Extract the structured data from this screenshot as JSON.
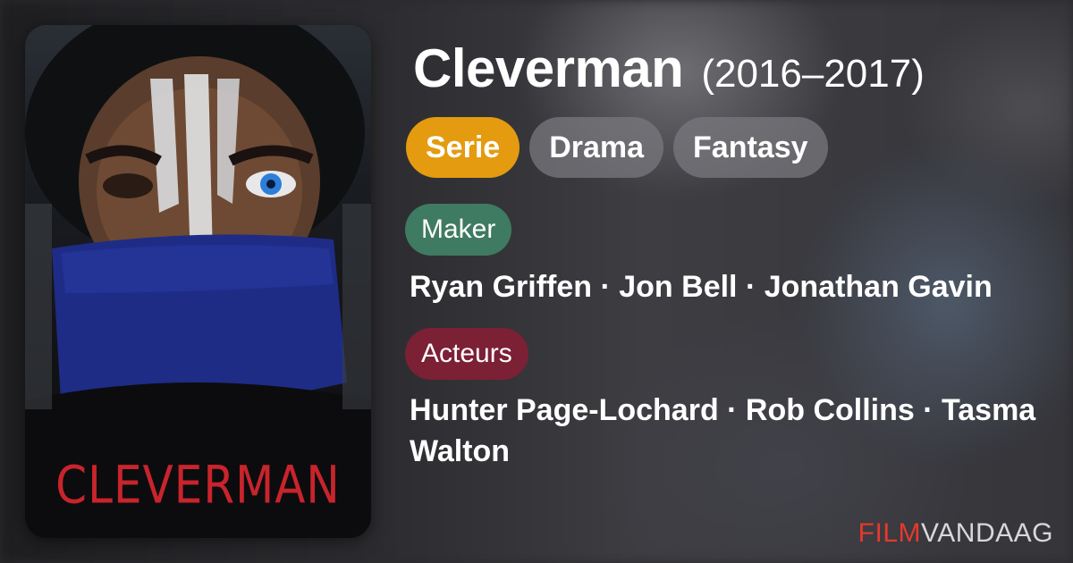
{
  "show": {
    "title": "Cleverman",
    "years": "(2016–2017)"
  },
  "poster": {
    "title_text": "CLEVERMAN"
  },
  "genres": [
    {
      "label": "Serie",
      "color": "#e49b0f"
    },
    {
      "label": "Drama"
    },
    {
      "label": "Fantasy"
    }
  ],
  "maker": {
    "label": "Maker",
    "names": "Ryan Griffen · Jon Bell · Jonathan Gavin"
  },
  "cast": {
    "label": "Acteurs",
    "names": "Hunter Page-Lochard · Rob Collins · Tasma Walton"
  },
  "brand": {
    "part1": "FILM",
    "part2": "VANDAAG"
  },
  "colors": {
    "accent": "#e49b0f",
    "maker_badge": "#3f7a62",
    "cast_badge": "#7b2035",
    "brand_red": "#e5392d"
  }
}
